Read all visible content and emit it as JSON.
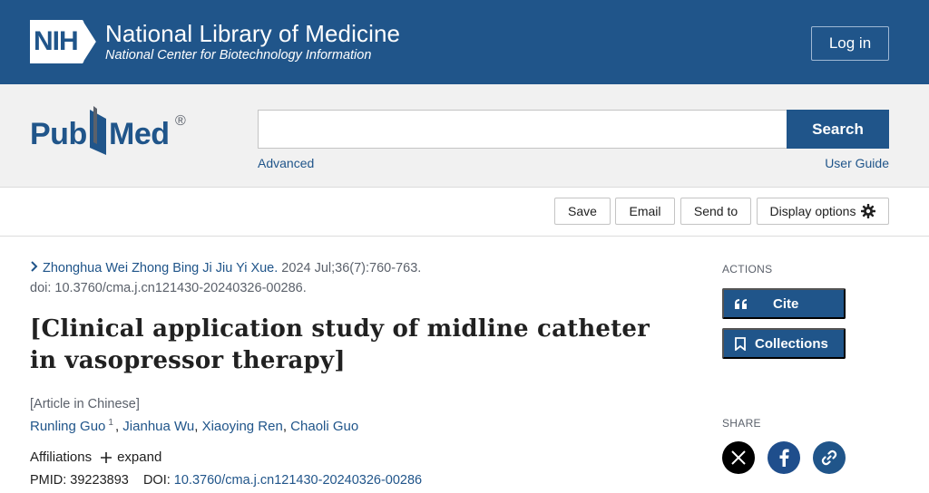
{
  "nih": {
    "badge": "NIH",
    "title": "National Library of Medicine",
    "subtitle": "National Center for Biotechnology Information",
    "login_label": "Log in"
  },
  "search": {
    "logo_text_left": "Pub",
    "logo_text_right": "Med",
    "logo_reg": "®",
    "placeholder": "",
    "button_label": "Search",
    "advanced_label": "Advanced",
    "user_guide_label": "User Guide"
  },
  "toolbar": {
    "save_label": "Save",
    "email_label": "Email",
    "send_label": "Send to",
    "display_label": "Display options"
  },
  "article": {
    "journal": "Zhonghua Wei Zhong Bing Ji Jiu Yi Xue.",
    "citation": " 2024 Jul;36(7):760-763.",
    "doi_line": "doi: 10.3760/cma.j.cn121430-20240326-00286.",
    "title": "[Clinical application study of midline catheter in vasopressor therapy]",
    "language": "[Article in Chinese]",
    "authors": {
      "first": "Runling Guo",
      "first_sup": "1",
      "second": "Jianhua Wu",
      "third": "Xiaoying Ren",
      "fourth": "Chaoli Guo"
    },
    "affiliations_label": "Affiliations",
    "expand_label": "expand",
    "pmid_label": "PMID: 39223893",
    "doi_label": "DOI:",
    "doi_value": "10.3760/cma.j.cn121430-20240326-00286"
  },
  "sidebar": {
    "actions_label": "ACTIONS",
    "cite_label": "Cite",
    "collections_label": "Collections",
    "share_label": "SHARE"
  },
  "colors": {
    "brand_blue": "#20558a",
    "link_blue": "#20558a",
    "muted_gray": "#5b616b"
  },
  "icons": [
    "chevron-right-icon",
    "gear-icon",
    "quote-icon",
    "bookmark-icon",
    "x-icon",
    "facebook-icon",
    "link-icon"
  ]
}
